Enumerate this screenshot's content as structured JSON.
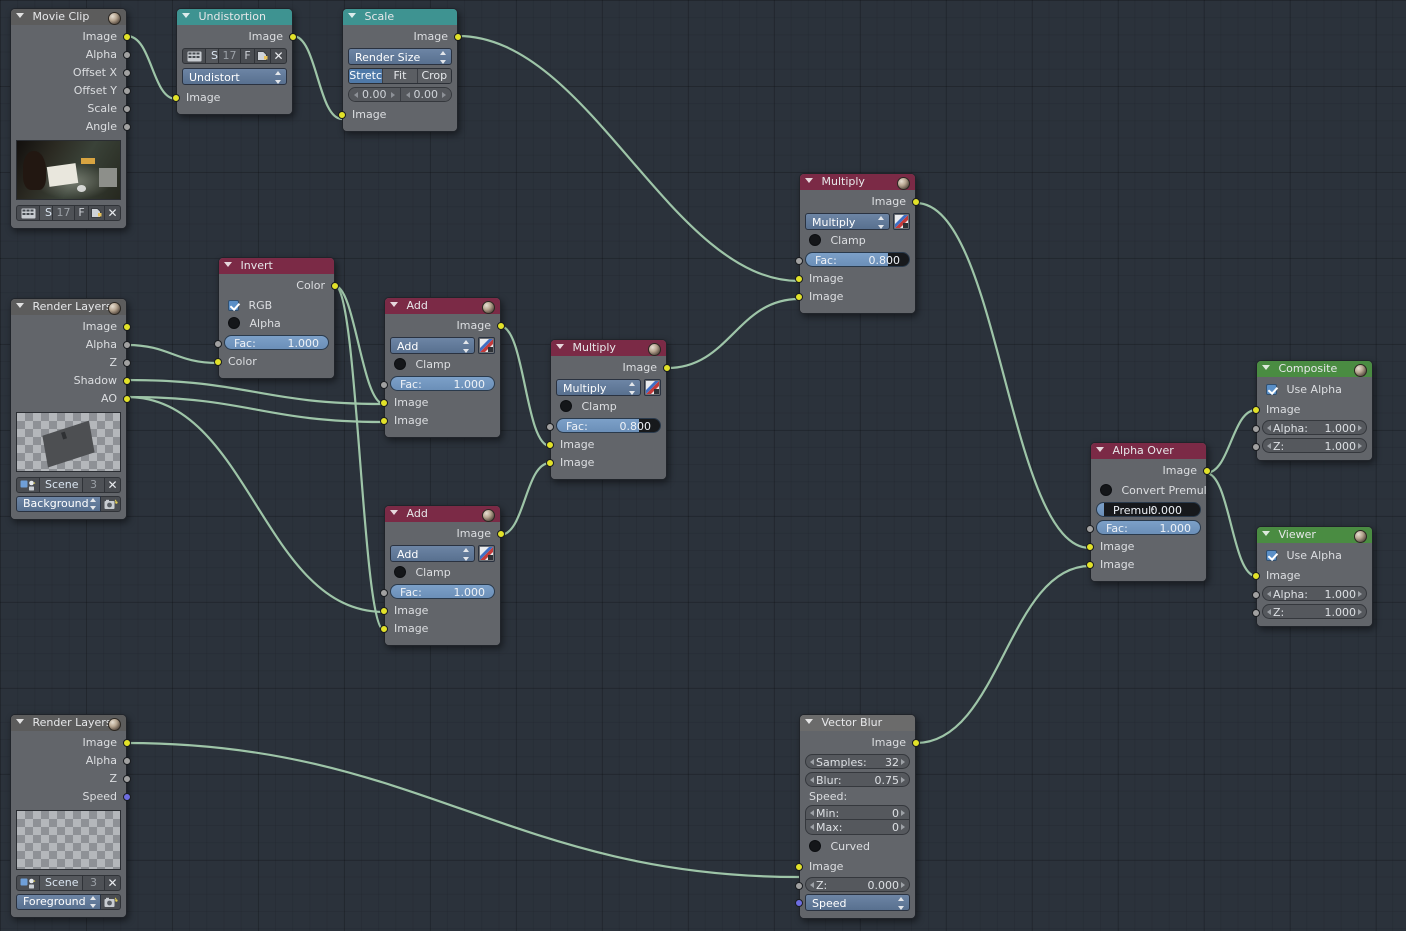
{
  "app": {
    "editor": "Blender Compositor Node Editor",
    "background_color": "#2b323b"
  },
  "palette": {
    "header_input": "#5c5c5c",
    "header_color": "#7b2a46",
    "header_output": "#4a8c42",
    "header_distort": "#3e9391",
    "node_body": "#62656a",
    "socket_image": "#e2e229",
    "socket_value": "#a1a1a1",
    "socket_vector": "#6d6de0",
    "link": "#9ec5a8"
  },
  "nodes": [
    {
      "id": "movie-clip",
      "title": "Movie Clip",
      "header_type": "input",
      "outputs": [
        "Image",
        "Alpha",
        "Offset X",
        "Offset Y",
        "Scale",
        "Angle"
      ],
      "preview": "movie-clip-thumbnail",
      "clip_widget": {
        "name": "Sce",
        "frame": "17",
        "fake_user": "F"
      }
    },
    {
      "id": "undistortion",
      "title": "Undistortion",
      "header_type": "distort",
      "outputs": [
        "Image"
      ],
      "inputs": [
        "Image"
      ],
      "clip_widget": {
        "name": "Sce",
        "frame": "17",
        "fake_user": "F"
      },
      "mode": "Undistort"
    },
    {
      "id": "scale",
      "title": "Scale",
      "header_type": "distort",
      "outputs": [
        "Image"
      ],
      "inputs": [
        "Image"
      ],
      "space": "Render Size",
      "fit_options": [
        "Stretc",
        "Fit",
        "Crop"
      ],
      "fit_selected": "Stretc",
      "offset_x": "0.00",
      "offset_y": "0.00"
    },
    {
      "id": "multiply-top",
      "title": "Multiply",
      "header_type": "color",
      "outputs": [
        "Image"
      ],
      "blend_mode": "Multiply",
      "clamp_label": "Clamp",
      "clamp_checked": false,
      "fac_label": "Fac:",
      "fac_value": "0.800",
      "fac_fill": 0.8,
      "inputs": [
        "Image",
        "Image"
      ]
    },
    {
      "id": "invert",
      "title": "Invert",
      "header_type": "color",
      "outputs": [
        "Color"
      ],
      "rgb_label": "RGB",
      "rgb_checked": true,
      "alpha_label": "Alpha",
      "alpha_checked": false,
      "fac_label": "Fac:",
      "fac_value": "1.000",
      "inputs": [
        "Color"
      ]
    },
    {
      "id": "add-top",
      "title": "Add",
      "header_type": "color",
      "outputs": [
        "Image"
      ],
      "blend_mode": "Add",
      "clamp_label": "Clamp",
      "clamp_checked": false,
      "fac_label": "Fac:",
      "fac_value": "1.000",
      "fac_fill": 1.0,
      "inputs": [
        "Image",
        "Image"
      ]
    },
    {
      "id": "add-bottom",
      "title": "Add",
      "header_type": "color",
      "outputs": [
        "Image"
      ],
      "blend_mode": "Add",
      "clamp_label": "Clamp",
      "clamp_checked": false,
      "fac_label": "Fac:",
      "fac_value": "1.000",
      "fac_fill": 1.0,
      "inputs": [
        "Image",
        "Image"
      ]
    },
    {
      "id": "multiply-mid",
      "title": "Multiply",
      "header_type": "color",
      "outputs": [
        "Image"
      ],
      "blend_mode": "Multiply",
      "clamp_label": "Clamp",
      "clamp_checked": false,
      "fac_label": "Fac:",
      "fac_value": "0.800",
      "fac_fill": 0.8,
      "inputs": [
        "Image",
        "Image"
      ]
    },
    {
      "id": "render-layers-bg",
      "title": "Render Layers",
      "header_type": "input",
      "outputs": [
        "Image",
        "Alpha",
        "Z",
        "Shadow",
        "AO"
      ],
      "scene_widget": {
        "name": "Scene",
        "users": "3"
      },
      "layer": "Background"
    },
    {
      "id": "render-layers-fg",
      "title": "Render Layers",
      "header_type": "input",
      "outputs": [
        "Image",
        "Alpha",
        "Z",
        "Speed"
      ],
      "scene_widget": {
        "name": "Scene",
        "users": "3"
      },
      "layer": "Foreground"
    },
    {
      "id": "vector-blur",
      "title": "Vector Blur",
      "header_type": "filter",
      "outputs": [
        "Image"
      ],
      "samples_label": "Samples:",
      "samples_value": "32",
      "blur_label": "Blur:",
      "blur_value": "0.75",
      "speed_section": "Speed:",
      "min_label": "Min:",
      "min_value": "0",
      "max_label": "Max:",
      "max_value": "0",
      "curved_label": "Curved",
      "curved_checked": false,
      "inputs": [
        "Image",
        "Z:",
        "Speed"
      ],
      "z_value": "0.000",
      "speed_input": "Speed"
    },
    {
      "id": "alpha-over",
      "title": "Alpha Over",
      "header_type": "color",
      "outputs": [
        "Image"
      ],
      "convert_premul_label": "Convert Premul",
      "convert_premul_checked": false,
      "premul_label": "Premul:",
      "premul_value": "0.000",
      "premul_fill": 0.06,
      "fac_label": "Fac:",
      "fac_value": "1.000",
      "inputs": [
        "Image",
        "Image"
      ]
    },
    {
      "id": "composite",
      "title": "Composite",
      "header_type": "output",
      "use_alpha_label": "Use Alpha",
      "use_alpha_checked": true,
      "inputs": [
        "Image"
      ],
      "alpha_label": "Alpha:",
      "alpha_value": "1.000",
      "z_label": "Z:",
      "z_value": "1.000"
    },
    {
      "id": "viewer",
      "title": "Viewer",
      "header_type": "output",
      "use_alpha_label": "Use Alpha",
      "use_alpha_checked": true,
      "inputs": [
        "Image"
      ],
      "alpha_label": "Alpha:",
      "alpha_value": "1.000",
      "z_label": "Z:",
      "z_value": "1.000"
    }
  ],
  "links": [
    {
      "from": "movie-clip.Image",
      "to": "undistortion.Image"
    },
    {
      "from": "undistortion.Image",
      "to": "scale.Image"
    },
    {
      "from": "scale.Image",
      "to": "multiply-top.Image1"
    },
    {
      "from": "render-layers-bg.Alpha",
      "to": "invert.Color"
    },
    {
      "from": "render-layers-bg.Shadow",
      "to": "add-top.Image1"
    },
    {
      "from": "render-layers-bg.AO",
      "to": "add-top.Image2"
    },
    {
      "from": "render-layers-bg.Shadow2",
      "to": "add-bottom.Image2"
    },
    {
      "from": "invert.Color",
      "to": "add-top.Image1b"
    },
    {
      "from": "invert.Color2",
      "to": "add-bottom.Image1"
    },
    {
      "from": "add-top.Image",
      "to": "multiply-mid.Image1"
    },
    {
      "from": "add-bottom.Image",
      "to": "multiply-mid.Image2"
    },
    {
      "from": "multiply-mid.Image",
      "to": "multiply-top.Image2"
    },
    {
      "from": "multiply-top.Image",
      "to": "alpha-over.Image1"
    },
    {
      "from": "render-layers-fg.Image",
      "to": "vector-blur.Image"
    },
    {
      "from": "vector-blur.Image",
      "to": "alpha-over.Image2"
    },
    {
      "from": "alpha-over.Image",
      "to": "composite.Image"
    },
    {
      "from": "alpha-over.Image",
      "to": "viewer.Image"
    }
  ]
}
